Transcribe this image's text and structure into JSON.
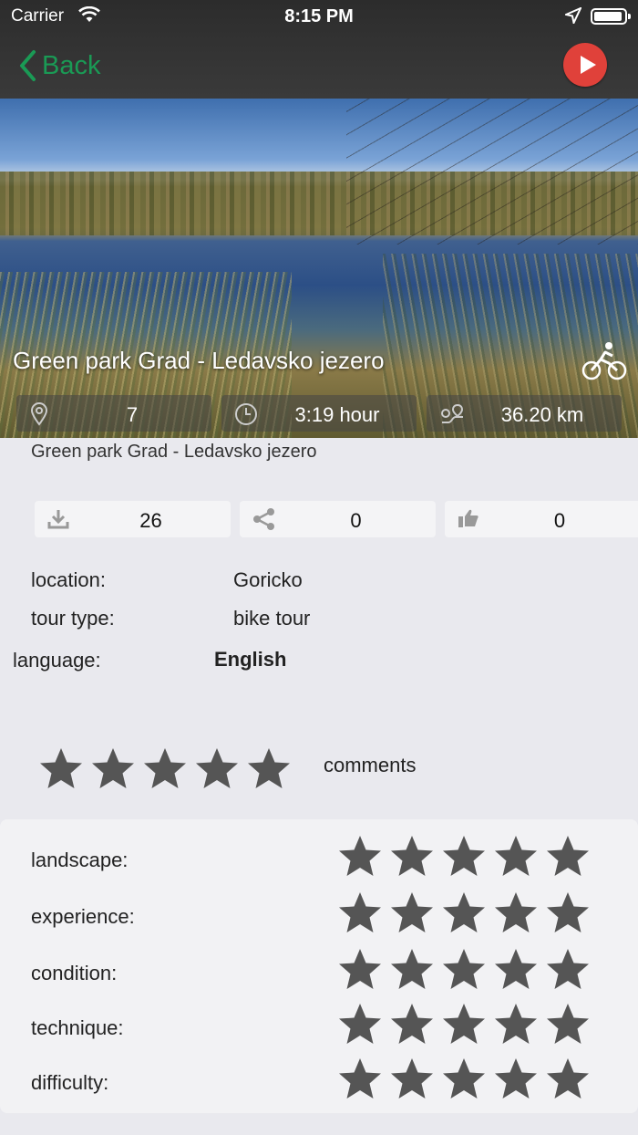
{
  "status": {
    "carrier": "Carrier",
    "time": "8:15 PM"
  },
  "nav": {
    "back_label": "Back"
  },
  "tour": {
    "title": "Green park Grad - Ledavsko jezero",
    "subtitle": "Green park Grad - Ledavsko jezero",
    "points": "7",
    "duration": "3:19 hour",
    "distance": "36.20 km"
  },
  "stats": {
    "downloads": "26",
    "shares": "0",
    "likes": "0"
  },
  "info": {
    "location_label": "location:",
    "location_value": "Goricko",
    "tour_type_label": "tour type:",
    "tour_type_value": "bike tour",
    "language_label": "language:",
    "language_value": "English"
  },
  "overall_rating": {
    "stars": 5,
    "max": 5
  },
  "comments_label": "comments",
  "ratings": [
    {
      "label": "landscape:",
      "stars": 5
    },
    {
      "label": "experience:",
      "stars": 5
    },
    {
      "label": "condition:",
      "stars": 5
    },
    {
      "label": "technique:",
      "stars": 5
    },
    {
      "label": "difficulty:",
      "stars": 5
    }
  ],
  "colors": {
    "accent": "#1a9a55",
    "play": "#e0413a",
    "star": "#555555"
  }
}
